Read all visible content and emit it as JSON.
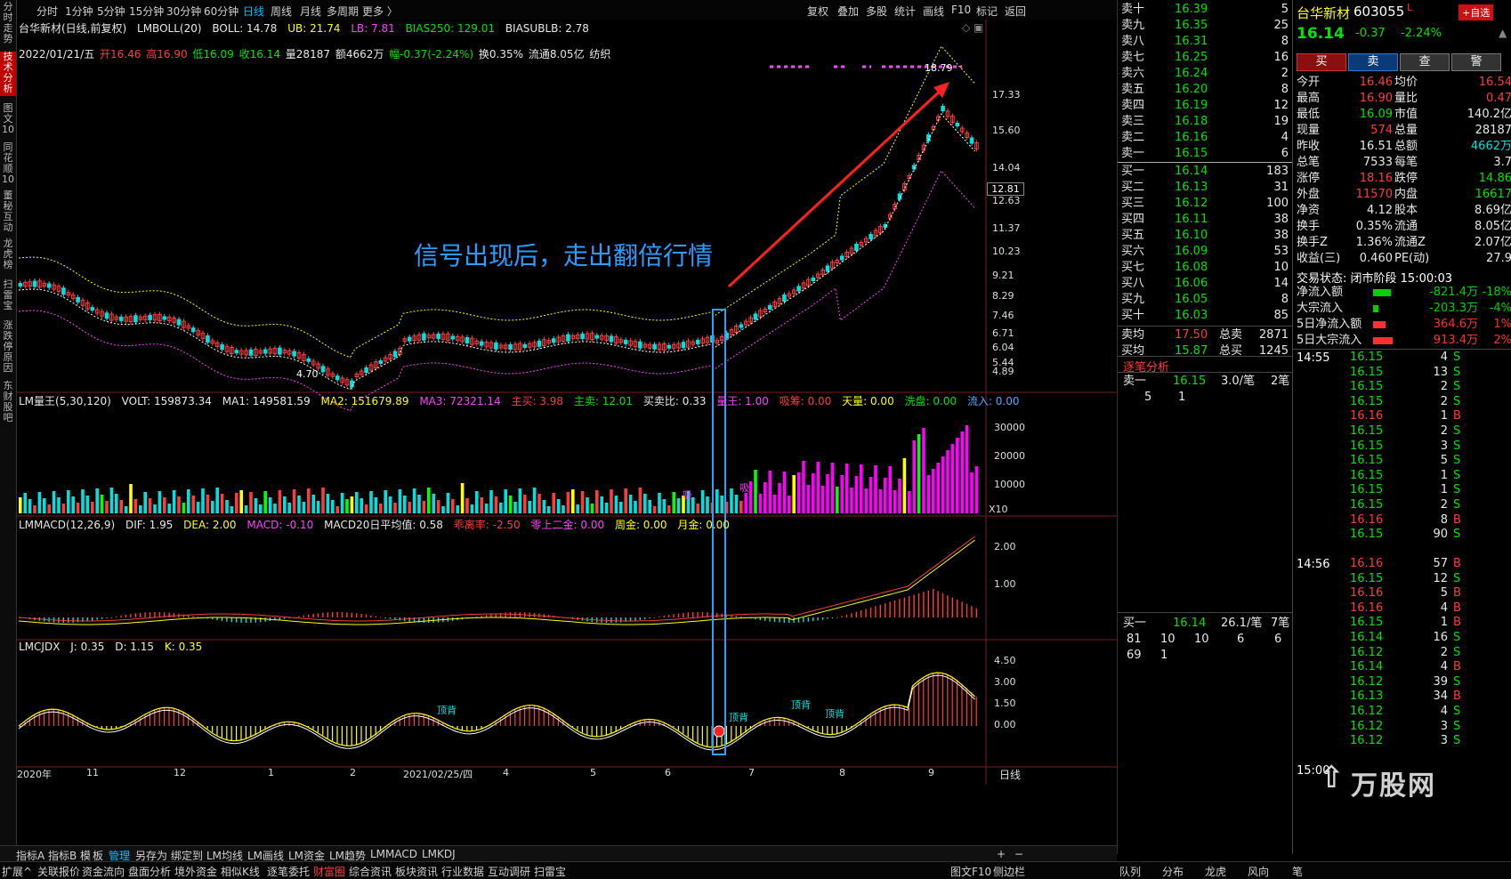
{
  "leftbar": [
    {
      "label": "分时走势",
      "active": false
    },
    {
      "label": "技术分析",
      "active": true
    },
    {
      "label": "图文10",
      "active": false
    },
    {
      "label": "同花顺10",
      "active": false
    },
    {
      "label": "董秘互动",
      "active": false
    },
    {
      "label": "龙虎榜",
      "active": false
    },
    {
      "label": "扫雷宝",
      "active": false
    },
    {
      "label": "涨跌停原因",
      "active": false
    },
    {
      "label": "东财股吧",
      "active": false
    }
  ],
  "toolbar": {
    "periods": [
      "分时",
      "1分钟",
      "5分钟",
      "15分钟",
      "30分钟",
      "60分钟",
      "日线",
      "周线",
      "月线",
      "多周期",
      "更多 〉"
    ],
    "active_period": "日线",
    "right": [
      "复权",
      "叠加",
      "多股",
      "统计",
      "画线",
      "F10",
      "标记",
      "返回"
    ]
  },
  "main": {
    "title": "台华新材(日线,前复权)",
    "indicator": "LMBOLL(20)",
    "boll": "BOLL: 14.78",
    "ub": "UB: 21.74",
    "lb": "LB: 7.81",
    "bias250": "BIAS250: 129.01",
    "biasublb": "BIASUBLB: 2.78",
    "info": {
      "date": "2022/01/21/五",
      "open": "开16.46",
      "high": "高16.90",
      "low": "低16.09",
      "close": "收16.14",
      "vol": "量28187",
      "amount": "额4662万",
      "change": "幅-0.37(-2.24%)",
      "turnover": "换0.35%",
      "float": "流通8.05亿",
      "industry": "纺织"
    },
    "annotation": "信号出现后，走出翻倍行情",
    "high_label": "18.79",
    "low_label": "4.70",
    "price_labels": [
      "17.33",
      "15.60",
      "14.04",
      "12.63",
      "11.37",
      "10.23",
      "9.21",
      "8.29",
      "7.46",
      "6.71",
      "6.04",
      "5.44",
      "4.89"
    ],
    "current_price_tag": "12.81"
  },
  "volume": {
    "title": "LM量王(5,30,120)",
    "volt": "VOLT: 159873.34",
    "ma1": "MA1: 149581.59",
    "ma2": "MA2: 151679.89",
    "ma3": "MA3: 72321.14",
    "zhumai": "主买: 3.98",
    "zhumai2": "主卖: 12.01",
    "mmb": "买卖比: 0.33",
    "lw": "量王: 1.00",
    "xs": "吸筹: 0.00",
    "tl": "天量: 0.00",
    "xp": "洗盘: 0.00",
    "lr": "流入: 0.00",
    "axis": [
      "30000",
      "20000",
      "10000"
    ],
    "unit": "X10",
    "marks": [
      "吸",
      "吸",
      "吸"
    ]
  },
  "macd": {
    "title": "LMMACD(12,26,9)",
    "dif": "DIF: 1.95",
    "dea": "DEA: 2.00",
    "macd": "MACD: -0.10",
    "avg20": "MACD20日平均值: 0.58",
    "dev": "乖离率: -2.50",
    "zero": "零上二金: 0.00",
    "week": "周金: 0.00",
    "month": "月金: 0.00",
    "axis": [
      "2.00",
      "1.00"
    ]
  },
  "kdj": {
    "title": "LMCJDX",
    "j": "J: 0.35",
    "d": "D: 1.15",
    "k": "K: 0.35",
    "axis": [
      "4.50",
      "3.00",
      "1.50",
      "0.00"
    ],
    "marks": [
      "顶背",
      "顶背",
      "顶背",
      "顶背"
    ]
  },
  "xaxis": {
    "labels": [
      "2020年",
      "11",
      "12",
      "1",
      "2",
      "2021/02/25/四",
      "4",
      "5",
      "6",
      "7",
      "8",
      "9"
    ],
    "right": "日线"
  },
  "quote": {
    "name": "台华新材",
    "code": "603055",
    "badge": "L",
    "zixuan": "+自选",
    "price": "16.14",
    "change": "-0.37",
    "pct": "-2.24%",
    "buttons": [
      "买",
      "卖",
      "查",
      "警"
    ],
    "sells": [
      {
        "label": "卖十",
        "price": "16.39",
        "vol": "5"
      },
      {
        "label": "卖九",
        "price": "16.35",
        "vol": "25"
      },
      {
        "label": "卖八",
        "price": "16.31",
        "vol": "8"
      },
      {
        "label": "卖七",
        "price": "16.25",
        "vol": "16"
      },
      {
        "label": "卖六",
        "price": "16.24",
        "vol": "2"
      },
      {
        "label": "卖五",
        "price": "16.20",
        "vol": "8"
      },
      {
        "label": "卖四",
        "price": "16.19",
        "vol": "12"
      },
      {
        "label": "卖三",
        "price": "16.18",
        "vol": "19"
      },
      {
        "label": "卖二",
        "price": "16.16",
        "vol": "4"
      },
      {
        "label": "卖一",
        "price": "16.15",
        "vol": "6"
      }
    ],
    "buys": [
      {
        "label": "买一",
        "price": "16.14",
        "vol": "183"
      },
      {
        "label": "买二",
        "price": "16.13",
        "vol": "31"
      },
      {
        "label": "买三",
        "price": "16.12",
        "vol": "100"
      },
      {
        "label": "买四",
        "price": "16.11",
        "vol": "38"
      },
      {
        "label": "买五",
        "price": "16.10",
        "vol": "38"
      },
      {
        "label": "买六",
        "price": "16.09",
        "vol": "53"
      },
      {
        "label": "买七",
        "price": "16.08",
        "vol": "10"
      },
      {
        "label": "买八",
        "price": "16.06",
        "vol": "14"
      },
      {
        "label": "买九",
        "price": "16.05",
        "vol": "8"
      },
      {
        "label": "买十",
        "price": "16.03",
        "vol": "85"
      }
    ],
    "avg_sell": {
      "label": "卖均",
      "price": "17.50",
      "tlabel": "总卖",
      "vol": "2871"
    },
    "avg_buy": {
      "label": "买均",
      "price": "15.87",
      "tlabel": "总买",
      "vol": "1245"
    },
    "stats": [
      {
        "k1": "今开",
        "v1": "16.46",
        "c1": "red",
        "k2": "均价",
        "v2": "16.54",
        "c2": "red"
      },
      {
        "k1": "最高",
        "v1": "16.90",
        "c1": "red",
        "k2": "量比",
        "v2": "0.47",
        "c2": "red"
      },
      {
        "k1": "最低",
        "v1": "16.09",
        "c1": "grn",
        "k2": "市值",
        "v2": "140.2亿",
        "c2": "wht"
      },
      {
        "k1": "现量",
        "v1": "574",
        "c1": "red",
        "k2": "总量",
        "v2": "28187",
        "c2": "wht"
      },
      {
        "k1": "昨收",
        "v1": "16.51",
        "c1": "wht",
        "k2": "总额",
        "v2": "4662万",
        "c2": "cya"
      },
      {
        "k1": "总笔",
        "v1": "7533",
        "c1": "wht",
        "k2": "每笔",
        "v2": "3.7",
        "c2": "wht"
      },
      {
        "k1": "涨停",
        "v1": "18.16",
        "c1": "red",
        "k2": "跌停",
        "v2": "14.86",
        "c2": "grn"
      },
      {
        "k1": "外盘",
        "v1": "11570",
        "c1": "red",
        "k2": "内盘",
        "v2": "16617",
        "c2": "grn"
      },
      {
        "k1": "净资",
        "v1": "4.12",
        "c1": "wht",
        "k2": "股本",
        "v2": "8.69亿",
        "c2": "wht"
      },
      {
        "k1": "换手",
        "v1": "0.35%",
        "c1": "wht",
        "k2": "流通",
        "v2": "8.05亿",
        "c2": "wht"
      },
      {
        "k1": "换手Z",
        "v1": "1.36%",
        "c1": "wht",
        "k2": "流通Z",
        "v2": "2.07亿",
        "c2": "wht"
      },
      {
        "k1": "收益(三)",
        "v1": "0.460",
        "c1": "wht",
        "k2": "PE(动)",
        "v2": "27.9",
        "c2": "wht"
      }
    ],
    "trade_state": "交易状态: 闭市阶段 15:00:03",
    "flows": [
      {
        "label": "净流入额",
        "value": "-821.4万",
        "pct": "-18%",
        "color": "#00d000"
      },
      {
        "label": "大宗流入",
        "value": "-203.3万",
        "pct": "-4%",
        "color": "#00d000"
      },
      {
        "label": "5日净流入额",
        "value": "364.6万",
        "pct": "1%",
        "color": "#ff3030"
      },
      {
        "label": "5日大宗流入",
        "value": "913.4万",
        "pct": "2%",
        "color": "#ff3030"
      }
    ],
    "tick_title": "逐笔分析",
    "tick_top": {
      "label": "卖一",
      "price": "16.15",
      "per": "3.0/笔",
      "count": "2笔",
      "a": "5",
      "b": "1"
    },
    "tick_bottom": {
      "label": "买一",
      "price": "16.14",
      "per": "26.1/笔",
      "count": "7笔",
      "row1": [
        "81",
        "10",
        "10",
        "6",
        "6"
      ],
      "row2": [
        "69",
        "1"
      ]
    },
    "trades_1455": {
      "time": "14:55",
      "rows": [
        [
          "16.15",
          "4",
          "S"
        ],
        [
          "16.15",
          "13",
          "S"
        ],
        [
          "16.15",
          "2",
          "S"
        ],
        [
          "16.15",
          "2",
          "S"
        ],
        [
          "16.16",
          "1",
          "B"
        ],
        [
          "16.15",
          "2",
          "S"
        ],
        [
          "16.15",
          "3",
          "S"
        ],
        [
          "16.15",
          "5",
          "S"
        ],
        [
          "16.15",
          "1",
          "S"
        ],
        [
          "16.15",
          "1",
          "S"
        ],
        [
          "16.15",
          "2",
          "S"
        ],
        [
          "16.16",
          "8",
          "B"
        ],
        [
          "16.15",
          "90",
          "S"
        ]
      ]
    },
    "trades_1456": {
      "time": "14:56",
      "rows": [
        [
          "16.16",
          "57",
          "B"
        ],
        [
          "16.15",
          "12",
          "S"
        ],
        [
          "16.16",
          "5",
          "B"
        ],
        [
          "16.16",
          "4",
          "B"
        ],
        [
          "16.15",
          "1",
          "B"
        ],
        [
          "16.14",
          "16",
          "S"
        ],
        [
          "16.12",
          "2",
          "S"
        ],
        [
          "16.14",
          "4",
          "B"
        ],
        [
          "16.12",
          "39",
          "S"
        ],
        [
          "16.13",
          "34",
          "B"
        ],
        [
          "16.12",
          "4",
          "S"
        ],
        [
          "16.12",
          "3",
          "S"
        ],
        [
          "16.12",
          "3",
          "S"
        ]
      ]
    },
    "trades_1500": {
      "time": "15:00"
    },
    "logo": "万股网"
  },
  "bottom1": [
    "指标A",
    "指标B",
    "模",
    "板",
    "管理",
    "另存为",
    "绑定到",
    "LM均线",
    "LM画线",
    "LM资金",
    "LM趋势",
    "LMMACD",
    "LMKDJ"
  ],
  "bottom2": [
    "扩展^",
    "关联报价",
    "资金流向",
    "盘面分析",
    "境外资金",
    "相似K线",
    "逐笔委托",
    "财富圈",
    "综合资讯",
    "板块资讯",
    "行业数据",
    "互动调研",
    "扫雷宝"
  ],
  "bottom2_right": [
    "图文F10",
    "侧边栏"
  ],
  "bottom_tabs": [
    "队列",
    "分布",
    "龙虎",
    "风向",
    "笔"
  ]
}
